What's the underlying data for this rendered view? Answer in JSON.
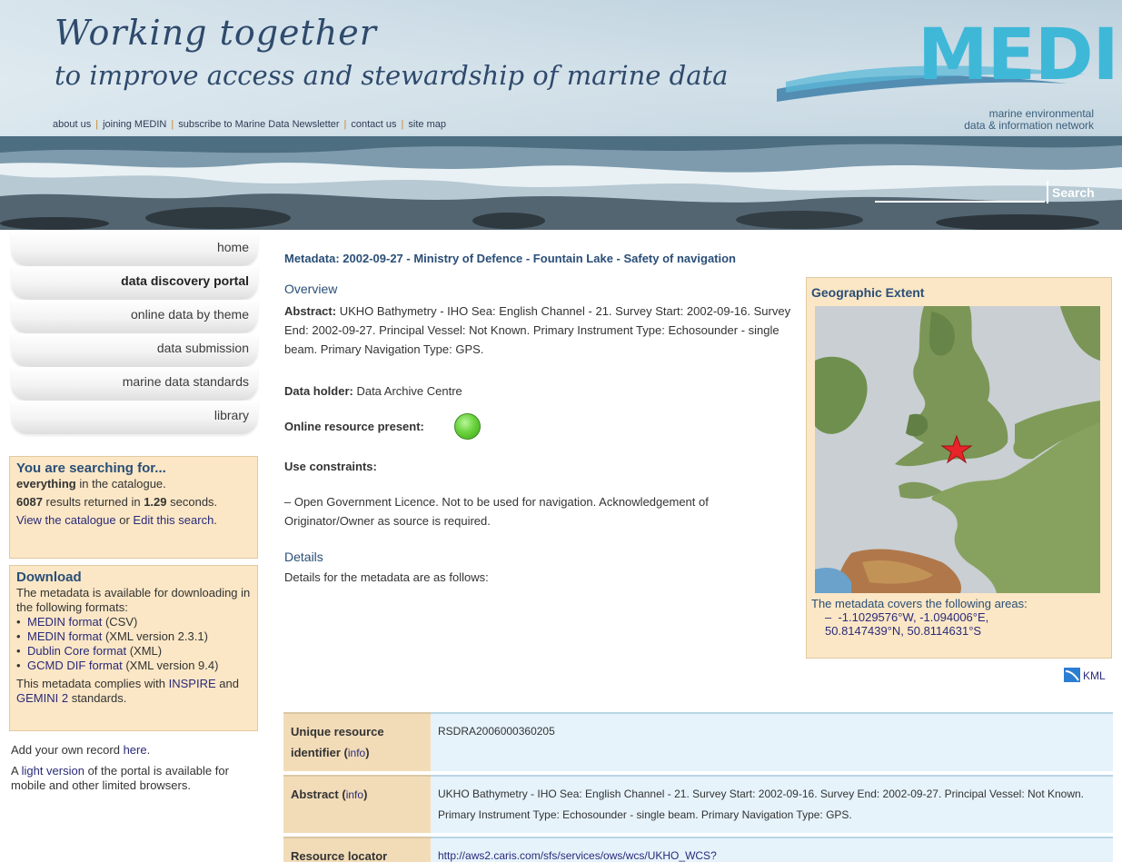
{
  "header": {
    "tagline_line1": "Working together",
    "tagline_line2": "to improve access and stewardship of marine data",
    "links": [
      "about us",
      "joining MEDIN",
      "subscribe to Marine Data Newsletter",
      "contact us",
      "site map"
    ],
    "logo_text": "MEDIN",
    "logo_sub1": "marine environmental",
    "logo_sub2": "data & information network",
    "search_value": "",
    "search_button": "Search"
  },
  "nav": {
    "items": [
      "home",
      "data discovery portal",
      "online data by theme",
      "data submission",
      "marine data standards",
      "library"
    ],
    "active": "data discovery portal"
  },
  "search_box": {
    "title": "You are searching for...",
    "term": "everything",
    "term_suffix": " in the catalogue.",
    "count": "6087",
    "count_mid": " results returned in ",
    "time": "1.29",
    "time_suffix": " seconds.",
    "view_link": "View the catalogue",
    "or_text": " or ",
    "edit_link": "Edit this search",
    "end": "."
  },
  "download_box": {
    "title": "Download",
    "intro": "The metadata is available for downloading in the following formats:",
    "formats": [
      {
        "link": "MEDIN format",
        "note": " (CSV)"
      },
      {
        "link": "MEDIN format",
        "note": " (XML version 2.3.1)"
      },
      {
        "link": "Dublin Core format",
        "note": " (XML)"
      },
      {
        "link": "GCMD DIF format",
        "note": " (XML version 9.4)"
      }
    ],
    "complies_pre": "This metadata complies with ",
    "inspire": "INSPIRE",
    "and": " and ",
    "gemini": "GEMINI 2",
    "complies_post": " standards."
  },
  "side_notes": {
    "add_pre": "Add your own record ",
    "add_link": "here",
    "add_post": ".",
    "light_pre": "A ",
    "light_link": "light version",
    "light_post": " of the portal is available for mobile and other limited browsers."
  },
  "main": {
    "title": "Metadata: 2002-09-27 - Ministry of Defence - Fountain Lake - Safety of navigation",
    "overview_head": "Overview",
    "abstract_label": "Abstract:",
    "abstract_text": " UKHO Bathymetry - IHO Sea: English Channel - 21. Survey Start: 2002-09-16. Survey End: 2002-09-27. Principal Vessel: Not Known. Primary Instrument Type: Echosounder - single beam. Primary Navigation Type: GPS.",
    "holder_label": "Data holder:",
    "holder_value": " Data Archive Centre",
    "online_label": "Online resource present:",
    "constraints_label": "Use constraints:",
    "constraints_text": "–  Open Government Licence. Not to be used for navigation. Acknowledgement of Originator/Owner as source is required.",
    "details_head": "Details",
    "details_text": "Details for the metadata are as follows:"
  },
  "geo": {
    "title": "Geographic Extent",
    "caption": "The metadata covers the following areas:",
    "dash": "–",
    "coords_line1": "-1.1029576°W, -1.094006°E,",
    "coords_line2": "50.8147439°N, 50.8114631°S",
    "kml": "KML"
  },
  "details_table": [
    {
      "key": "Unique resource identifier",
      "info": "info",
      "value": "RSDRA2006000360205"
    },
    {
      "key": "Abstract",
      "info": "info",
      "value": "UKHO Bathymetry - IHO Sea: English Channel - 21. Survey Start: 2002-09-16. Survey End: 2002-09-27. Principal Vessel: Not Known. Primary Instrument Type: Echosounder - single beam. Primary Navigation Type: GPS."
    },
    {
      "key": "Resource locator",
      "info": "",
      "value": "http://aws2.caris.com/sfs/services/ows/wcs/UKHO_WCS?"
    }
  ],
  "colors": {
    "heading_blue": "#2a4e77",
    "box_beige": "#fbe7c6",
    "value_blue": "#e6f3fb",
    "online_green": "#6ad33d",
    "marker_red": "#e8242b"
  }
}
